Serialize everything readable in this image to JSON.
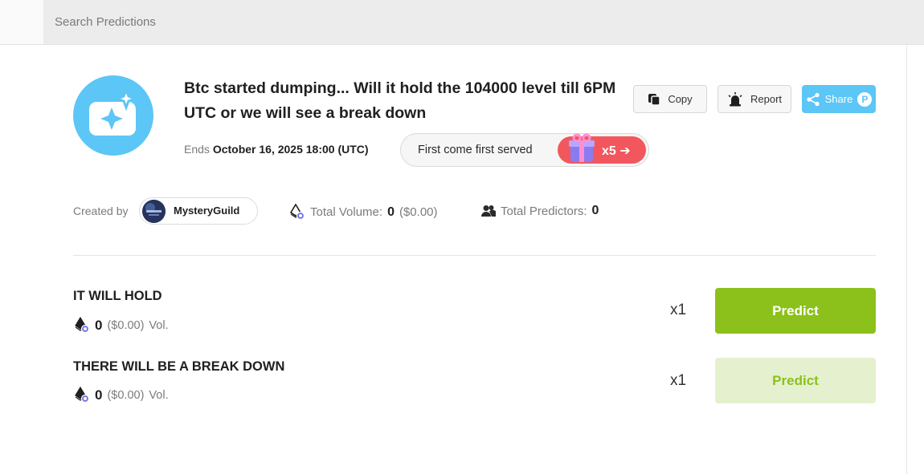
{
  "search": {
    "placeholder": "Search Predictions"
  },
  "prediction": {
    "title": "Btc started dumping... Will it hold the 104000 level till 6PM UTC or we will see a break down",
    "ends_label": "Ends",
    "ends_date": "October 16, 2025 18:00 (UTC)",
    "fcfs_label": "First come first served",
    "fcfs_multiplier": "x5 ➔"
  },
  "actions": {
    "copy": "Copy",
    "report": "Report",
    "share": "Share",
    "share_badge": "P"
  },
  "creator": {
    "label": "Created by",
    "name": "MysteryGuild"
  },
  "stats": {
    "volume_label": "Total Volume:",
    "volume_value": "0",
    "volume_usd": "($0.00)",
    "predictors_label": "Total Predictors:",
    "predictors_value": "0"
  },
  "options": [
    {
      "title": "IT WILL HOLD",
      "volume": "0",
      "volume_usd": "($0.00)",
      "vol_label": "Vol.",
      "multiplier": "x1",
      "button": "Predict"
    },
    {
      "title": "THERE WILL BE A BREAK DOWN",
      "volume": "0",
      "volume_usd": "($0.00)",
      "vol_label": "Vol.",
      "multiplier": "x1",
      "button": "Predict"
    }
  ],
  "colors": {
    "accent_blue": "#5cc6f6",
    "predict_green": "#8cc11b",
    "predict_green_light": "#e5f0cf",
    "fcfs_red": "#f2575d"
  },
  "icons": [
    "camera-sparkle-icon",
    "copy-icon",
    "siren-icon",
    "share-icon",
    "eth-icon",
    "users-icon",
    "gift-icon"
  ]
}
